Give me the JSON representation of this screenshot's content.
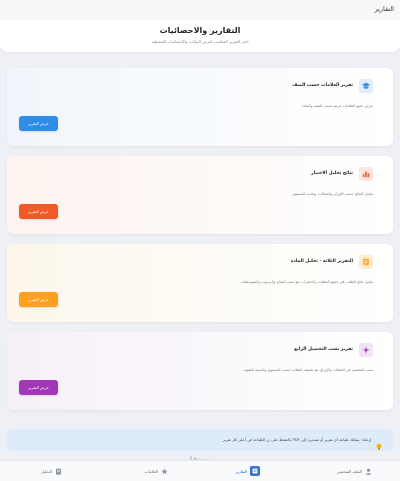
{
  "app": {
    "title": "التقارير"
  },
  "header": {
    "title": "التقارير والاحصائيات",
    "subtitle": "اختر التقرير المناسب لعرض البيانات والإحصائيات التفصيلية"
  },
  "reports": [
    {
      "title": "تقرير العلامات حسب الصف",
      "description": "عرض جميع العلامات مرتبة حسب الصف والمادة",
      "button": "عرض التقرير",
      "icon": "graduation-cap-icon",
      "color": "#2f8ce7"
    },
    {
      "title": "نتائج تحليل الاختبار",
      "description": "تحليل النتائج حسب الأوزان والمجالات وتحديد المستوى",
      "button": "عرض التقرير",
      "icon": "bar-chart-icon",
      "color": "#f05a28"
    },
    {
      "title": "التقرير الثلاثة - تحليل المادة",
      "description": "تحليل نتائج الطلاب في جميع الحلقات والاختبارات مع نسب النجاح والرسوب والمتوسطات",
      "button": "عرض التقرير",
      "icon": "document-icon",
      "color": "#fba020"
    },
    {
      "title": "تقرير نسب التحصيل الرابع",
      "description": "نسب التحصيل في الحلقات والأوراق مع تصنيف الطلاب حسب المستوى والنسبة المئوية",
      "button": "عرض التقرير",
      "icon": "sparkle-icon",
      "color": "#a238b7"
    }
  ],
  "info": {
    "text": "إرشاد: يمكنك طباعة أي تقرير أو تصديره إلى PDF بالضغط على زر الطباعة في أعلى كل تقرير",
    "icon": "lightbulb-icon"
  },
  "nav": {
    "profile": "الملف الشخصي",
    "reports": "التقارير",
    "favorites": "العلامات",
    "settings": "التحليل"
  },
  "watermark": {
    "main": "مستقل",
    "sub": "mostaql.com"
  }
}
